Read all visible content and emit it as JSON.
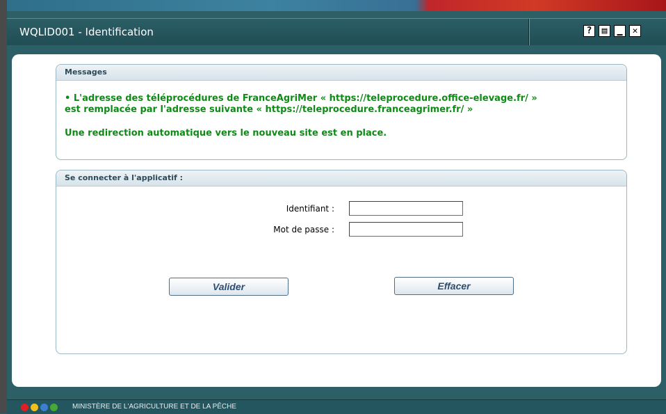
{
  "window": {
    "title": "WQLID001 - Identification",
    "buttons": [
      {
        "name": "help",
        "glyph": "?"
      },
      {
        "name": "print",
        "glyph": "▤"
      },
      {
        "name": "minimize",
        "glyph": "▁"
      },
      {
        "name": "close",
        "glyph": "✕"
      }
    ]
  },
  "messages": {
    "header": "Messages",
    "line1": "•  L'adresse des téléprocédures de FranceAgriMer « https://teleprocedure.office-elevage.fr/ »",
    "line2": "est remplacée par l'adresse suivante « https://teleprocedure.franceagrimer.fr/ »",
    "line3": "Une redirection automatique vers le nouveau site est en place."
  },
  "login": {
    "header": "Se connecter à l'applicatif :",
    "username_label": "Identifiant :",
    "username_value": "",
    "password_label": "Mot de passe :",
    "password_value": "",
    "submit_label": "Valider",
    "clear_label": "Effacer"
  },
  "footer": {
    "text": "MINISTÈRE DE L'AGRICULTURE ET DE LA PÊCHE",
    "dot_colors": [
      "#e02020",
      "#f0c020",
      "#3a7fd0",
      "#44aa33"
    ]
  },
  "colors": {
    "message_text": "#0f8a16",
    "window_teal": "#2d5f66"
  }
}
